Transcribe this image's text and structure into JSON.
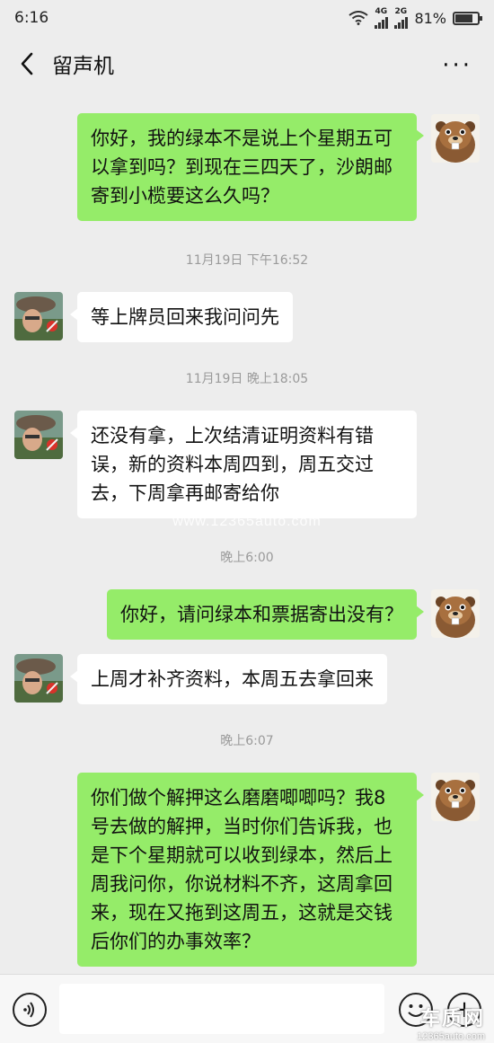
{
  "status_bar": {
    "time": "6:16",
    "network_1": "4G",
    "network_2": "2G",
    "battery_percent": "81%",
    "battery_level": 0.81
  },
  "nav": {
    "title": "留声机",
    "more": "···"
  },
  "messages": [
    {
      "side": "right",
      "text": "你好，我的绿本不是说上个星期五可以拿到吗？到现在三四天了，沙朗邮寄到小榄要这么久吗？"
    },
    {
      "side": "left",
      "text": "等上牌员回来我问问先"
    },
    {
      "side": "left",
      "text": "还没有拿，上次结清证明资料有错误，新的资料本周四到，周五交过去，下周拿再邮寄给你"
    },
    {
      "side": "right",
      "text": "你好，请问绿本和票据寄出没有？"
    },
    {
      "side": "left",
      "text": "上周才补齐资料，本周五去拿回来"
    },
    {
      "side": "right",
      "text": "你们做个解押这么磨磨唧唧吗？我8号去做的解押，当时你们告诉我，也是下个星期就可以收到绿本，然后上周我问你，你说材料不齐，这周拿回来，现在又拖到这周五，这就是交钱后你们的办事效率？"
    }
  ],
  "timestamps": [
    "11月19日 下午16:52",
    "11月19日 晚上18:05",
    "晚上6:00",
    "晚上6:07"
  ],
  "watermark": "www.12365auto.com",
  "input_bar": {
    "placeholder": ""
  },
  "logo_watermark": {
    "line1": "车质网",
    "line2": "12365auto.com"
  },
  "colors": {
    "sent_bubble": "#95ec69",
    "received_bubble": "#ffffff",
    "background": "#ededed"
  }
}
